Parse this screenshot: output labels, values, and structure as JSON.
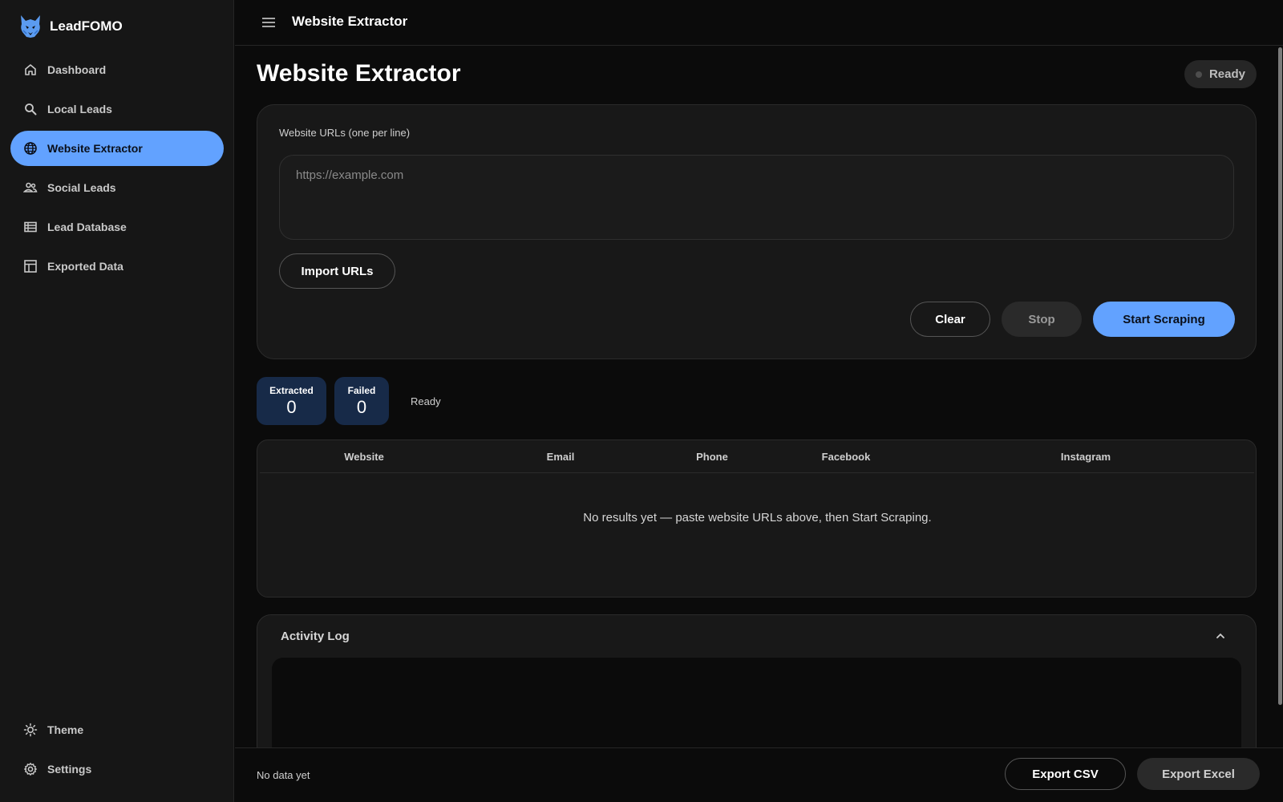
{
  "brand": {
    "name": "LeadFOMO",
    "logo_icon": "lynx-logo-icon",
    "accent": "#62a2ff"
  },
  "sidebar": {
    "items": [
      {
        "label": "Dashboard",
        "icon": "home-icon",
        "active": false
      },
      {
        "label": "Local Leads",
        "icon": "search-icon",
        "active": false
      },
      {
        "label": "Website Extractor",
        "icon": "globe-icon",
        "active": true
      },
      {
        "label": "Social Leads",
        "icon": "people-icon",
        "active": false
      },
      {
        "label": "Lead Database",
        "icon": "list-icon",
        "active": false
      },
      {
        "label": "Exported Data",
        "icon": "table-icon",
        "active": false
      }
    ],
    "bottom_items": [
      {
        "label": "Theme",
        "icon": "sun-icon"
      },
      {
        "label": "Settings",
        "icon": "gear-icon"
      }
    ]
  },
  "topbar": {
    "title": "Website Extractor",
    "menu_icon": "hamburger-icon"
  },
  "page": {
    "title": "Website Extractor",
    "status": "Ready"
  },
  "form": {
    "label": "Website URLs (one per line)",
    "value": "",
    "placeholder": "https://example.com",
    "import_label": "Import URLs",
    "clear_label": "Clear",
    "stop_label": "Stop",
    "start_label": "Start Scraping"
  },
  "stats": {
    "extracted_label": "Extracted",
    "extracted_value": "0",
    "failed_label": "Failed",
    "failed_value": "0",
    "status_text": "Ready"
  },
  "table": {
    "columns": [
      "Website",
      "Email",
      "Phone",
      "Facebook",
      "Instagram"
    ],
    "rows": [],
    "empty_message": "No results yet — paste website URLs above, then Start Scraping."
  },
  "log": {
    "title": "Activity Log",
    "toggle_icon": "chevron-up-icon"
  },
  "footer": {
    "status": "No data yet",
    "export_csv_label": "Export CSV",
    "export_excel_label": "Export Excel"
  }
}
